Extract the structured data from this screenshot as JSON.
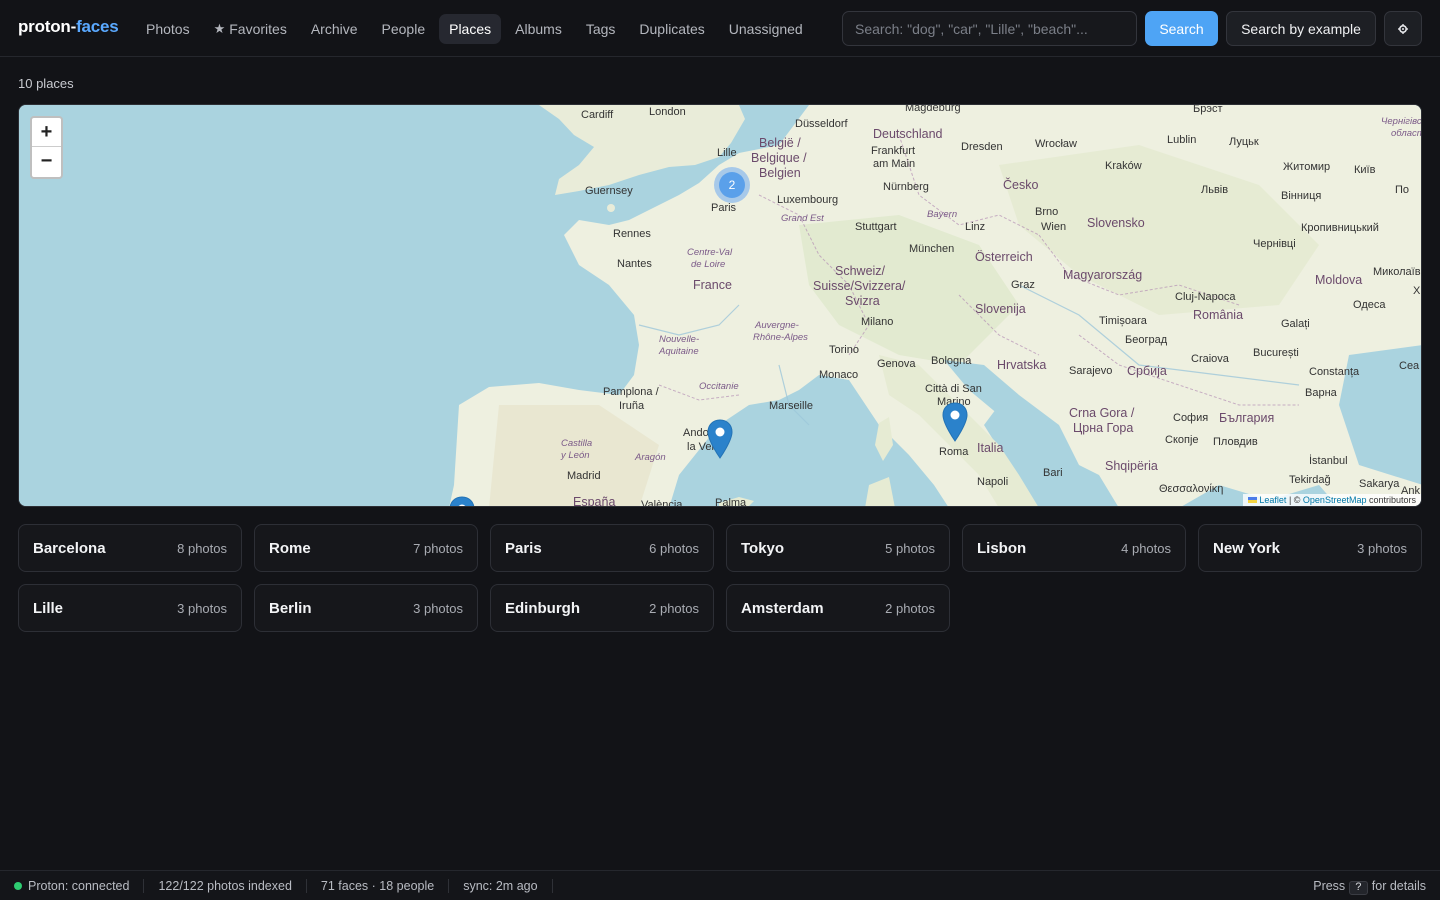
{
  "app": {
    "logo_part1": "proton-",
    "logo_part2": "faces"
  },
  "nav": {
    "items": [
      {
        "label": "Photos"
      },
      {
        "label": "Favorites",
        "icon": "star-icon"
      },
      {
        "label": "Archive"
      },
      {
        "label": "People"
      },
      {
        "label": "Places",
        "active": true
      },
      {
        "label": "Albums"
      },
      {
        "label": "Tags"
      },
      {
        "label": "Duplicates"
      },
      {
        "label": "Unassigned"
      }
    ]
  },
  "search": {
    "placeholder": "Search: \"dog\", \"car\", \"Lille\", \"beach\"...",
    "button_label": "Search",
    "example_button_label": "Search by example",
    "settings_icon": "gear-icon"
  },
  "places_count": "10 places",
  "map": {
    "zoom_in": "+",
    "zoom_out": "−",
    "attribution_leaflet": "Leaflet",
    "attribution_sep": " | © ",
    "attribution_osm": "OpenStreetMap",
    "attribution_tail": " contributors",
    "cluster_count": "2",
    "labels": {
      "cardiff": "Cardiff",
      "london": "London",
      "lille": "Lille",
      "guernsey": "Guernsey",
      "paris": "Paris",
      "rennes": "Rennes",
      "nantes": "Nantes",
      "france": "France",
      "belgique1": "België /",
      "belgique2": "Belgique /",
      "belgique3": "Belgien",
      "luxembourg": "Luxembourg",
      "grandest": "Grand Est",
      "centre1": "Centre-Val",
      "centre2": "de Loire",
      "duesseldorf": "Düsseldorf",
      "deutschland": "Deutschland",
      "magdeburg": "Magdeburg",
      "frankfurt1": "Frankfurt",
      "frankfurt2": "am Main",
      "dresden": "Dresden",
      "wroclaw": "Wrocław",
      "krakow": "Kraków",
      "lublin": "Lublin",
      "brest": "Брэст",
      "lutsk": "Луцьк",
      "zhytomyr": "Житомир",
      "kyiv": "Київ",
      "nuernberg": "Nürnberg",
      "cesko": "Česko",
      "lviv": "Львів",
      "vinnytsia": "Вінниця",
      "stuttgart": "Stuttgart",
      "bayern": "Bayern",
      "linz": "Linz",
      "brno": "Brno",
      "wien": "Wien",
      "slovensko": "Slovensko",
      "muenchen": "München",
      "oesterreich": "Österreich",
      "chernivtsi": "Чернівці",
      "kropyv": "Кропивницький",
      "schweiz1": "Schweiz/",
      "schweiz2": "Suisse/Svizzera/",
      "schweiz3": "Svizra",
      "graz": "Graz",
      "magyar": "Magyarország",
      "moldova": "Moldova",
      "mykolaiv": "Миколаїв",
      "odesa": "Одеса",
      "cluj": "Cluj-Napoca",
      "romania": "România",
      "nouvelle1": "Nouvelle-",
      "nouvelle2": "Aquitaine",
      "auvergne1": "Auvergne-",
      "auvergne2": "Rhône-Alpes",
      "milano": "Milano",
      "slovenija": "Slovenija",
      "timisoara": "Timișoara",
      "galati": "Galați",
      "torino": "Torino",
      "beograd": "Београд",
      "hrvatska": "Hrvatska",
      "craiova": "Craiova",
      "bucuresti": "București",
      "pamplona1": "Pamplona /",
      "pamplona2": "Iruña",
      "occitanie": "Occitanie",
      "monaco": "Monaco",
      "genova": "Genova",
      "bologna": "Bologna",
      "sarajevo": "Sarajevo",
      "srbija": "Србија",
      "constanta": "Constanța",
      "marseille": "Marseille",
      "sanmarino1": "Città di San",
      "sanmarino2": "Marino",
      "varna": "Варна",
      "andorra1": "Ando",
      "andorra2": "la Vel",
      "crnagora1": "Crna Gora /",
      "crnagora2": "Црна Гора",
      "sofia": "София",
      "balgaria": "България",
      "castilla1": "Castilla",
      "castilla2": "y León",
      "aragon": "Aragón",
      "italia": "Italia",
      "skopje": "Скопје",
      "plovdiv": "Пловдив",
      "roma": "Roma",
      "shqiperia": "Shqipëria",
      "istanbul": "İstanbul",
      "madrid": "Madrid",
      "bari": "Bari",
      "napoli": "Napoli",
      "tekirdag": "Tekirdağ",
      "sakarya": "Sakarya",
      "espana": "España",
      "valencia": "València",
      "palma": "Palma",
      "thessaloniki": "Θεσσαλονίκη",
      "ankara": "Ank",
      "po": "По",
      "sea": "Сеа",
      "ukr1": "Чернігівська",
      "ukr2": "область",
      "x": "Х"
    }
  },
  "places": [
    {
      "name": "Barcelona",
      "photos": "8 photos"
    },
    {
      "name": "Rome",
      "photos": "7 photos"
    },
    {
      "name": "Paris",
      "photos": "6 photos"
    },
    {
      "name": "Tokyo",
      "photos": "5 photos"
    },
    {
      "name": "Lisbon",
      "photos": "4 photos"
    },
    {
      "name": "New York",
      "photos": "3 photos"
    },
    {
      "name": "Lille",
      "photos": "3 photos"
    },
    {
      "name": "Berlin",
      "photos": "3 photos"
    },
    {
      "name": "Edinburgh",
      "photos": "2 photos"
    },
    {
      "name": "Amsterdam",
      "photos": "2 photos"
    }
  ],
  "status": {
    "connection": "Proton: connected",
    "indexed": "122/122 photos indexed",
    "faces": "71 faces · 18 people",
    "sync": "sync: 2m ago",
    "help_prefix": "Press",
    "help_key": "?",
    "help_suffix": "for details",
    "connection_color": "#2ecc71"
  },
  "colors": {
    "accent": "#4ea4f5",
    "logo_accent": "#5aa9ff",
    "background": "#121317"
  }
}
